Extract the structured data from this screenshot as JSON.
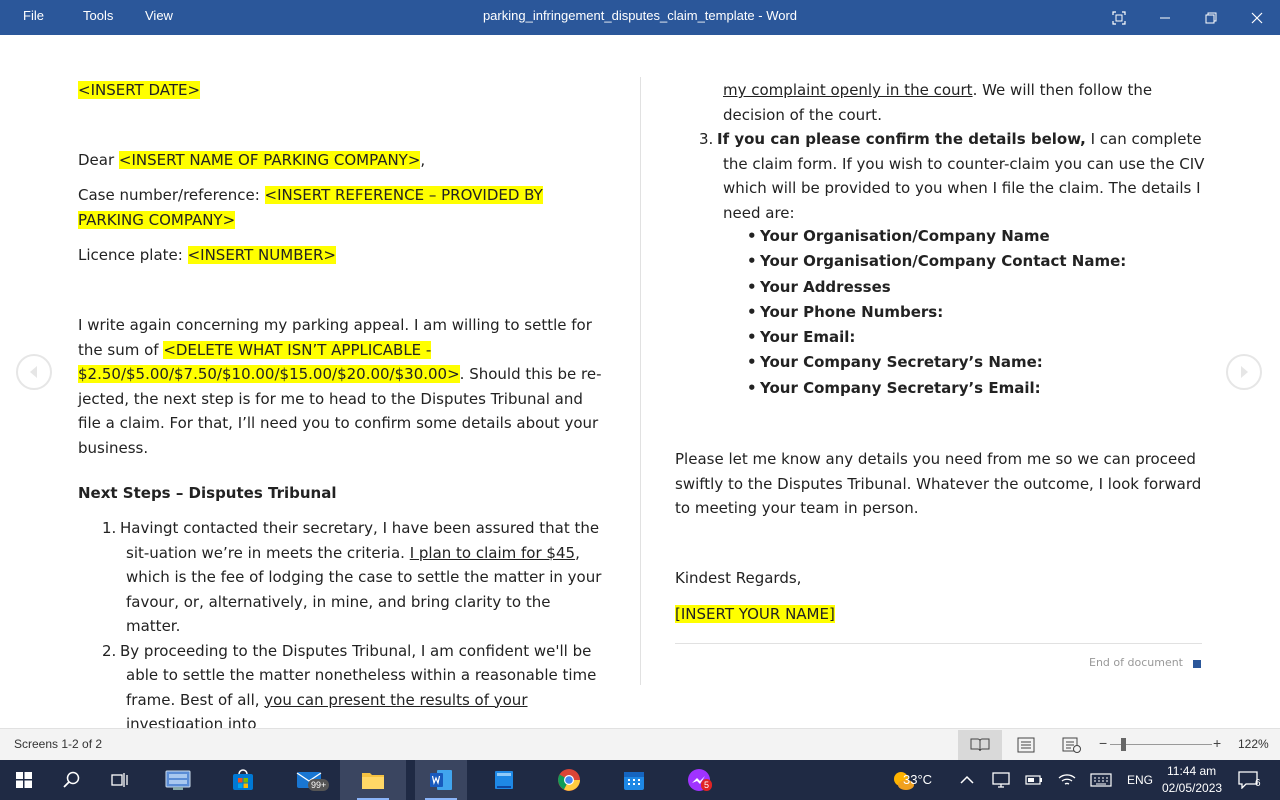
{
  "app": {
    "menu": [
      "File",
      "Tools",
      "View"
    ],
    "title": "parking_infringement_disputes_claim_template  -  Word"
  },
  "colors": {
    "titlebar": "#2b579a",
    "highlight": "#ffff00",
    "taskbar": "#1f2a44"
  },
  "doc": {
    "date": "<INSERT DATE>",
    "dear_prefix": "Dear ",
    "dear_name": "<INSERT NAME OF PARKING COMPANY>",
    "dear_suffix": ",",
    "case_label": "Case number/reference: ",
    "case_value": "<INSERT REFERENCE – PROVIDED BY PARKING COMPANY>",
    "plate_label": "Licence plate: ",
    "plate_value": "<INSERT NUMBER>",
    "para1_a": "I write again concerning my parking appeal. I am willing to settle for the sum of ",
    "para1_hl": "<DELETE WHAT ISN’T APPLICABLE - $2.50/$5.00/$7.50/$10.00/$15.00/$20.00/$30.00>",
    "para1_b": ". Should this be re-jected, the next step is for me to head to the Disputes Tribunal and file a claim. For that, I’ll need you to confirm some details about your business.",
    "heading": "Next Steps – Disputes Tribunal",
    "step1_num": "1.",
    "step1_a": "Havingt contacted their secretary, I have been assured that the sit-uation we’re in meets the criteria. ",
    "step1_u": "I plan to claim for $45",
    "step1_b": ", which is the fee of lodging the case to settle the matter in your favour, or, alternatively, in mine, and bring clarity to the matter.",
    "step2_num": "2.",
    "step2_a": "By proceeding to the Disputes Tribunal, I am confident we'll be able to settle the matter nonetheless within a reasonable time frame. Best of all, ",
    "step2_u": "you can present the results of your investigation into",
    "step2_cont_u": "my complaint openly in the court",
    "step2_cont_b": ". We will then follow the decision of the court.",
    "step3_num": "3.",
    "step3_bold": "If you can please confirm the details below,",
    "step3_rest": " I can complete the claim form. If you wish to counter-claim you can use the CIV which will be provided to you when I file the claim. The details I need are:",
    "details": [
      "Your Organisation/Company Name",
      "Your Organisation/Company Contact Name:",
      "Your Addresses",
      "Your Phone Numbers:",
      "Your Email:",
      "Your Company Secretary’s Name:",
      "Your Company Secretary’s Email:"
    ],
    "closing_para": "Please let me know any details you need from me so we can proceed swiftly to the Disputes Tribunal. Whatever the outcome, I look forward to meeting your team in person.",
    "regards": "Kindest Regards,",
    "name": "[INSERT YOUR NAME]",
    "end_of_document": "End of document"
  },
  "status": {
    "screens": "Screens 1-2 of 2",
    "zoom": "122%",
    "zoom_fraction": 0.13
  },
  "taskbar": {
    "mail_badge": "99+",
    "messenger_badge": "5",
    "weather": "33°C",
    "language": "ENG",
    "time": "11:44 am",
    "date": "02/05/2023",
    "notifications": "6"
  }
}
